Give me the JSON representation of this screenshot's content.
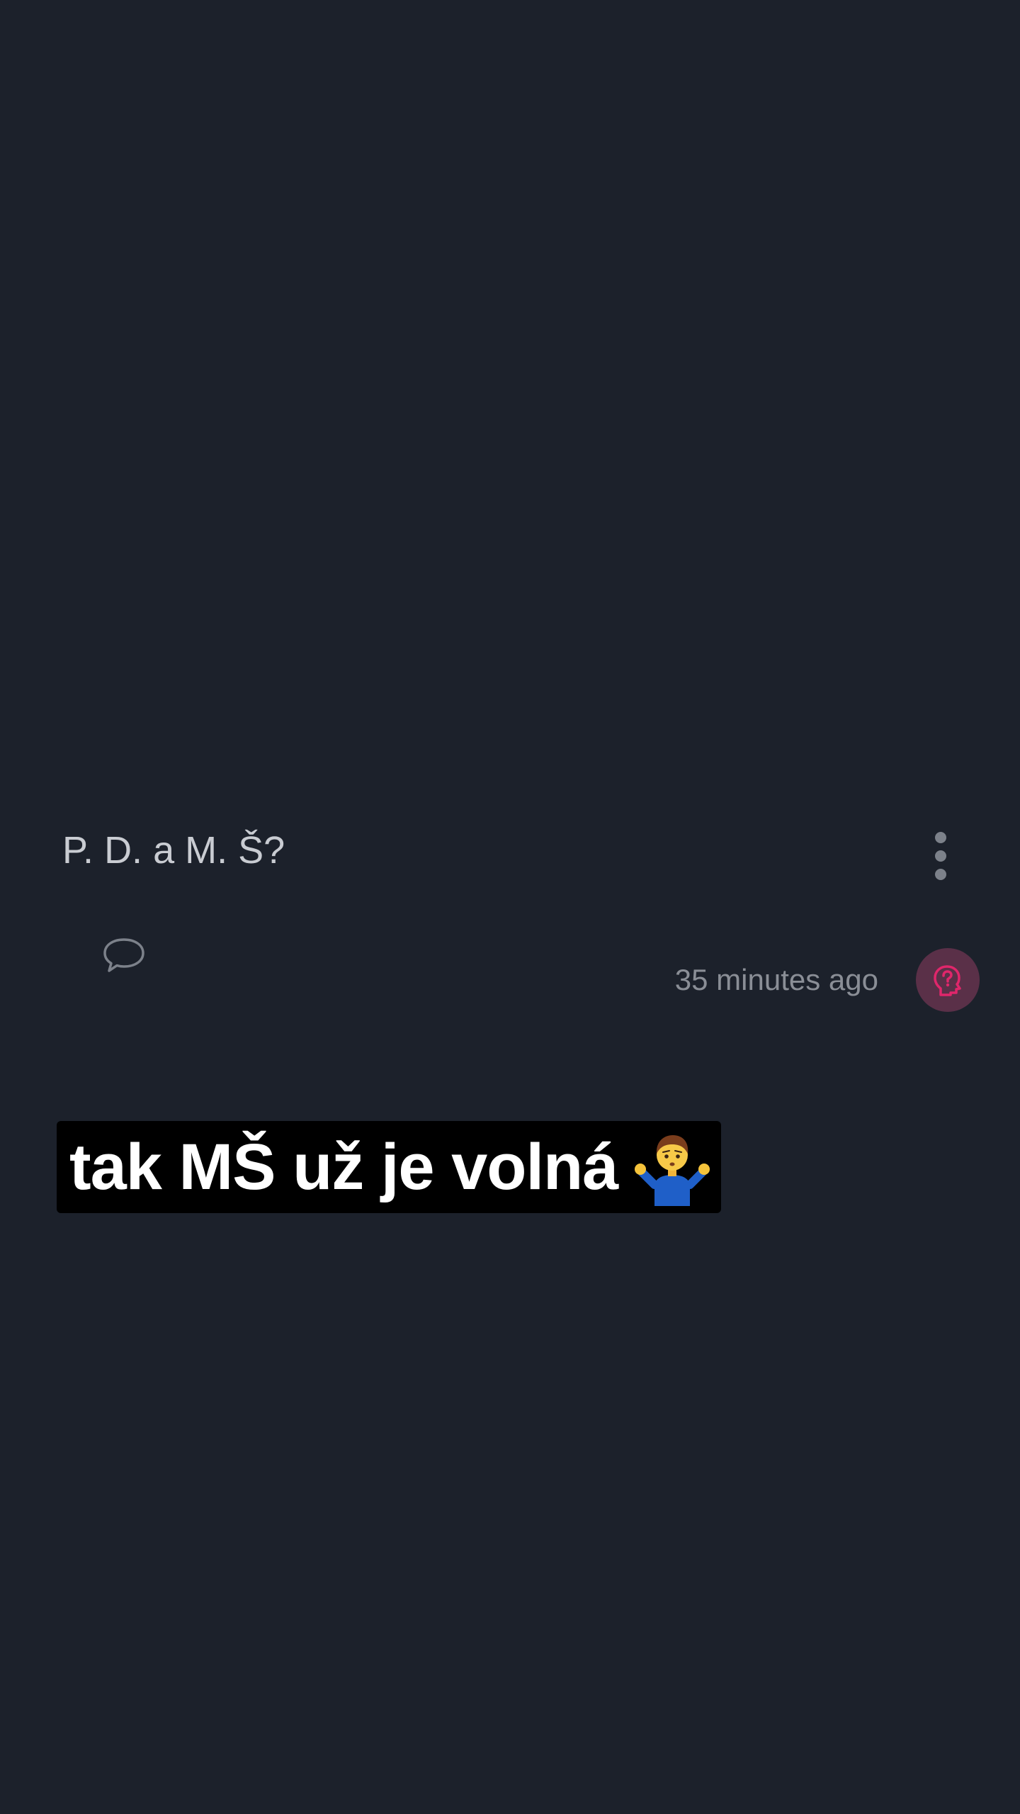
{
  "post": {
    "title": "P. D. a M. Š?",
    "timestamp": "35 minutes ago",
    "story_text": "tak MŠ už je volná"
  },
  "icons": {
    "more": "more-vertical-icon",
    "comment": "comment-bubble-icon",
    "question": "question-head-icon",
    "emoji": "person-shrugging-emoji"
  },
  "colors": {
    "background": "#1c212b",
    "accent": "#e0266b",
    "accent_bg": "#5a3048"
  }
}
